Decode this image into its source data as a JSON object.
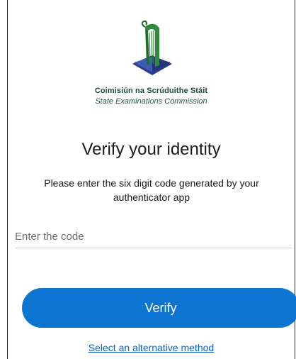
{
  "brand": {
    "irish_name": "Coimisiún na Scrúduithe Stáit",
    "english_name": "State Examinations Commission",
    "logo_icon": "harp-book-logo",
    "colors": {
      "brand_green": "#1c4e3a",
      "harp_green": "#2f8a3e",
      "book_blue": "#2b3c8a",
      "accent_blue": "#0d74d1"
    }
  },
  "page": {
    "heading": "Verify your identity",
    "instruction": "Please enter the six digit code generated by your authenticator app"
  },
  "code_field": {
    "value": "",
    "placeholder": "Enter the code"
  },
  "actions": {
    "verify_label": "Verify",
    "alternative_label": "Select an alternative method"
  }
}
